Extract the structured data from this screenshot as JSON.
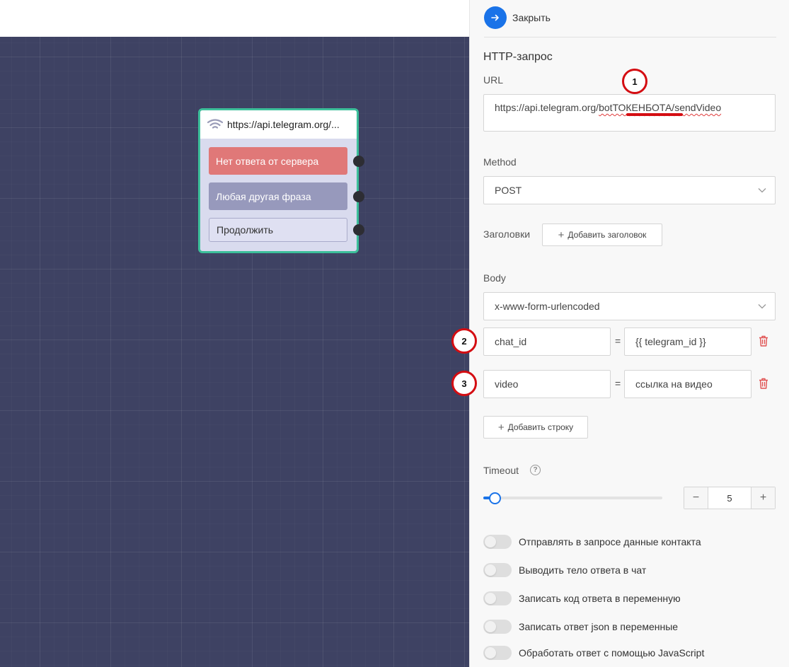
{
  "node": {
    "title": "https://api.telegram.org/...",
    "buttons": [
      {
        "label": "Нет ответа от сервера"
      },
      {
        "label": "Любая другая фраза"
      },
      {
        "label": "Продолжить"
      }
    ]
  },
  "panel": {
    "close_label": "Закрыть",
    "title": "HTTP-запрос",
    "url": {
      "label": "URL",
      "value_prefix": "https://api.telegram.org/",
      "value_highlight": "botТОКЕНБОТА/sendVideo"
    },
    "method": {
      "label": "Method",
      "value": "POST"
    },
    "headers": {
      "label": "Заголовки",
      "add_button": "Добавить заголовок"
    },
    "body": {
      "label": "Body",
      "type": "x-www-form-urlencoded",
      "rows": [
        {
          "key": "chat_id",
          "value": "{{ telegram_id }}"
        },
        {
          "key": "video",
          "value": "ссылка на видео"
        }
      ],
      "equals": "=",
      "add_row": "Добавить строку"
    },
    "timeout": {
      "label": "Timeout",
      "help": "?",
      "value": "5",
      "minus": "−",
      "plus": "+",
      "slider_fraction": 0.06
    },
    "toggles": [
      {
        "label": "Отправлять в запросе данные контакта",
        "on": false
      },
      {
        "label": "Выводить тело ответа в чат",
        "on": false
      },
      {
        "label": "Записать код ответа в переменную",
        "on": false
      },
      {
        "label": "Записать ответ json в переменные",
        "on": false
      },
      {
        "label": "Обработать ответ с помощью JavaScript",
        "on": false
      }
    ]
  },
  "annotations": [
    "1",
    "2",
    "3"
  ],
  "colors": {
    "accent": "#1a73e8",
    "node_border": "#3cbf9a",
    "annotation": "#d40d12",
    "canvas": "#3e4263"
  }
}
